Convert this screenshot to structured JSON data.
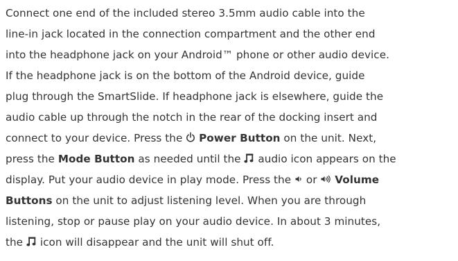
{
  "icons": {
    "power": "power-icon",
    "music_note": "music-note-icon",
    "volume_down": "volume-down-icon",
    "volume_up": "volume-up-icon"
  },
  "colors": {
    "text": "#333333",
    "background": "#ffffff"
  },
  "instructions": {
    "l1": "Connect one end of the included stereo 3.5mm audio cable into the",
    "l2": "line-in jack located in the connection compartment and the other end",
    "l3": "into the headphone jack on your Android™ phone or other audio device.",
    "l4": "If the headphone jack is on the bottom of the Android device, guide",
    "l5": "plug through the SmartSlide. If headphone jack is elsewhere, guide the",
    "l6": "audio cable up through the notch in the rear of the docking insert and",
    "l7a": "connect to your device. Press the ",
    "l7_power_button": "Power Button",
    "l7b": " on the unit. Next,",
    "l8a": "press the ",
    "l8_mode_button": "Mode Button",
    "l8b": " as needed until the ",
    "l8c": " audio icon appears on the",
    "l9": "display. Put your audio device in play mode. Press the ",
    "l9_or": " or ",
    "l9_volume": "Volume",
    "l10_buttons": "Buttons",
    "l10b": " on the unit to adjust listening level. When you are through",
    "l11": "listening, stop or pause play on your audio device.  In about 3 minutes,",
    "l12a": "the ",
    "l12b": " icon will disappear and the unit will shut off."
  }
}
